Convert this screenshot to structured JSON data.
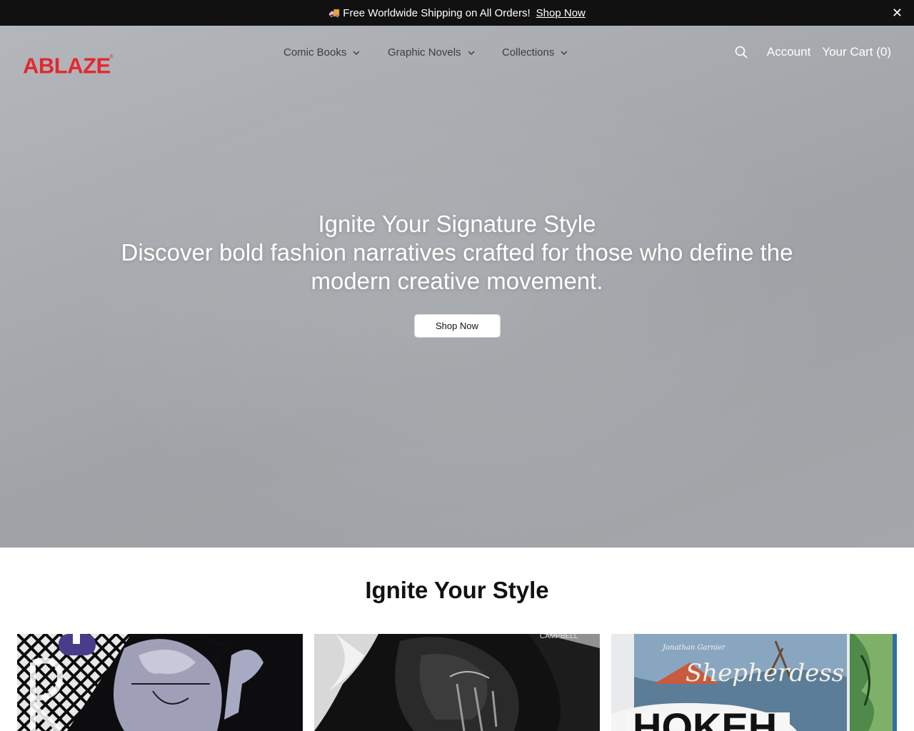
{
  "announcement": {
    "icon": "truck-icon",
    "message": "Free Worldwide Shipping on All Orders!",
    "link_label": "Shop Now",
    "close_label": "✕"
  },
  "header": {
    "logo_text": "ABLAZE",
    "logo_color": "#e3282f",
    "nav": [
      {
        "label": "Comic Books"
      },
      {
        "label": "Graphic Novels"
      },
      {
        "label": "Collections"
      }
    ],
    "account_label": "Account",
    "cart_label": "Your Cart (0)"
  },
  "hero": {
    "title": "Ignite Your Signature Style",
    "subtitle": "Discover bold fashion narratives crafted for those who define the modern creative movement.",
    "button_label": "Shop Now"
  },
  "section": {
    "title": "Ignite Your Style"
  },
  "cards": [
    {
      "icon": "manga-cover-image"
    },
    {
      "icon": "noir-comic-cover-image"
    },
    {
      "icon": "graphic-novel-covers-image",
      "cover_text_top": "Jonathan Garnier",
      "cover_title": "Shepherdess"
    }
  ]
}
